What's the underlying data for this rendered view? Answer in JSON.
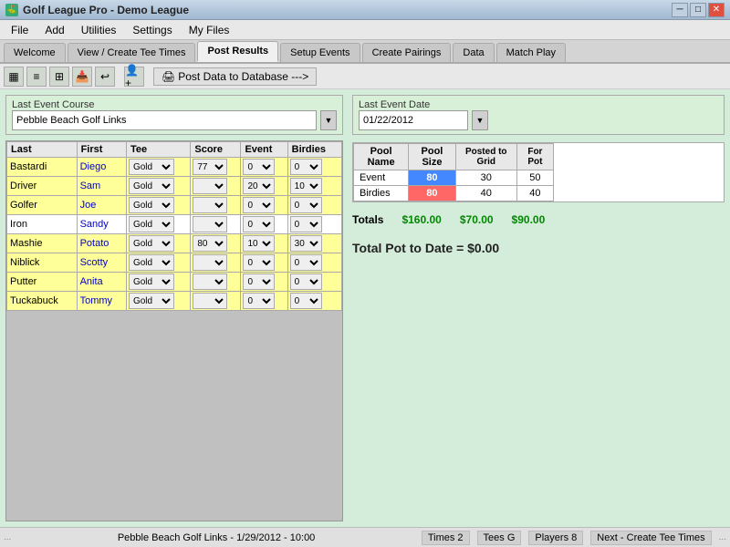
{
  "titlebar": {
    "title": "Golf League Pro - Demo League",
    "minimize": "─",
    "maximize": "□",
    "close": "✕"
  },
  "menubar": {
    "items": [
      "File",
      "Add",
      "Utilities",
      "Settings",
      "My Files"
    ]
  },
  "tabs": [
    {
      "label": "Welcome",
      "active": false
    },
    {
      "label": "View / Create Tee Times",
      "active": false
    },
    {
      "label": "Post Results",
      "active": true
    },
    {
      "label": "Setup Events",
      "active": false
    },
    {
      "label": "Create Pairings",
      "active": false
    },
    {
      "label": "Data",
      "active": false
    },
    {
      "label": "Match Play",
      "active": false
    }
  ],
  "toolbar": {
    "post_btn_label": "Post Data to Database --->"
  },
  "left_panel": {
    "course_label": "Last Event Course",
    "course_value": "Pebble Beach Golf Links",
    "table": {
      "headers": [
        "Last",
        "First",
        "Tee",
        "Score",
        "Event",
        "Birdies"
      ],
      "rows": [
        {
          "last": "Bastardi",
          "first": "Diego",
          "tee": "Gold",
          "score": "77",
          "event": "0",
          "birdies": "0",
          "yellow": true
        },
        {
          "last": "Driver",
          "first": "Sam",
          "tee": "Gold",
          "score": "",
          "event": "20",
          "birdies": "10",
          "yellow": true
        },
        {
          "last": "Golfer",
          "first": "Joe",
          "tee": "Gold",
          "score": "",
          "event": "0",
          "birdies": "0",
          "yellow": true
        },
        {
          "last": "Iron",
          "first": "Sandy",
          "tee": "Gold",
          "score": "",
          "event": "0",
          "birdies": "0",
          "yellow": false
        },
        {
          "last": "Mashie",
          "first": "Potato",
          "tee": "Gold",
          "score": "80",
          "event": "10",
          "birdies": "30",
          "yellow": true
        },
        {
          "last": "Niblick",
          "first": "Scotty",
          "tee": "Gold",
          "score": "",
          "event": "0",
          "birdies": "0",
          "yellow": true
        },
        {
          "last": "Putter",
          "first": "Anita",
          "tee": "Gold",
          "score": "",
          "event": "0",
          "birdies": "0",
          "yellow": true
        },
        {
          "last": "Tuckabuck",
          "first": "Tommy",
          "tee": "Gold",
          "score": "",
          "event": "0",
          "birdies": "0",
          "yellow": true
        }
      ]
    }
  },
  "right_panel": {
    "date_label": "Last Event Date",
    "date_value": "01/22/2012",
    "pool_grid": {
      "headers": [
        "Pool Name",
        "Pool Size",
        "Posted to Grid",
        "For Pot"
      ],
      "rows": [
        {
          "name": "Event",
          "pool_size": "80",
          "posted": "30",
          "for_pot": "50"
        },
        {
          "name": "Birdies",
          "pool_size": "80",
          "posted": "40",
          "for_pot": "40"
        }
      ]
    },
    "totals_label": "Totals",
    "total1": "$160.00",
    "total2": "$70.00",
    "total3": "$90.00",
    "pot_total": "Total Pot to Date = $0.00"
  },
  "statusbar": {
    "course_info": "Pebble Beach Golf Links - 1/29/2012 - 10:00",
    "times": "Times 2",
    "tees": "Tees G",
    "players": "Players 8",
    "next": "Next - Create Tee Times",
    "dots": "..."
  }
}
